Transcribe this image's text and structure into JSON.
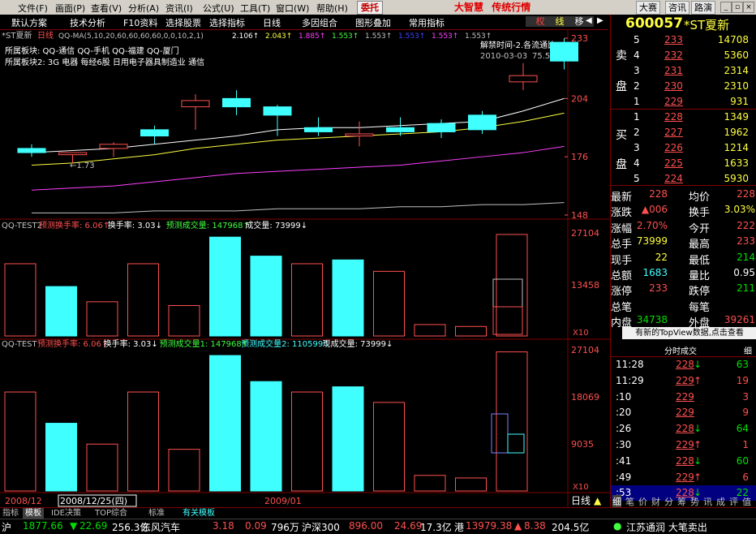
{
  "menubar": {
    "items": [
      "文件(F)",
      "画面(P)",
      "查看(V)",
      "分析(A)",
      "资讯(I)",
      "公式(U)",
      "工具(T)",
      "窗口(W)",
      "帮助(H)"
    ],
    "trade_label": "委托",
    "brand_name": "大智慧",
    "brand_slogan": "传统行情",
    "tab_dajiang": "大赛",
    "tab_zixun": "咨讯",
    "tab_lulun": "路演"
  },
  "toolbar": {
    "items": [
      "默认方案",
      "技术分析",
      "F10资料",
      "选择股票",
      "选择指标",
      "日线",
      "多因组合",
      "图形叠加",
      "常用指标"
    ],
    "right_buttons": [
      "权",
      "线",
      "移"
    ]
  },
  "chart": {
    "title_stock": "*ST夏新",
    "title_period": "日线",
    "ma_header": "QQ-MA(5,10,20,60,60,60,60,0,0,10,2,1)",
    "ma_values": [
      {
        "v": "2.106↑",
        "color": "#ffffff"
      },
      {
        "v": "2.043↑",
        "color": "#ffff40"
      },
      {
        "v": "1.885↑",
        "color": "#ff40ff"
      },
      {
        "v": "1.553↑",
        "color": "#40ff40"
      },
      {
        "v": "1.553↑",
        "color": "#c0c0c0"
      },
      {
        "v": "1.553↑",
        "color": "#4040ff"
      },
      {
        "v": "1.553↑",
        "color": "#ff40ff"
      },
      {
        "v": "1.553↑",
        "color": "#c0c0c0"
      }
    ],
    "board1": "所属板块: QQ-通信 QQ-手机 QQ-福建 QQ-厦门",
    "board2": "所属板块2: 3G 电器 每经6股 日用电子器具制造业 通信",
    "info_box": "解禁时间-2.各流通比",
    "info_date": "2010-03-03",
    "info_pct": "75.5%",
    "low_label": "1.73",
    "price_axis": [
      "233",
      "204",
      "176",
      "148"
    ]
  },
  "panel2": {
    "title": "QQ-TEST2",
    "legend": [
      {
        "label": "预测换手率: 6.06↑",
        "color": "#ff5050"
      },
      {
        "label": "换手率: 3.03↓",
        "color": "#ffffff"
      },
      {
        "label": "预测成交量: 147968↑",
        "color": "#40ff40"
      },
      {
        "label": "成交量: 73999↓",
        "color": "#ffffff"
      }
    ],
    "axis": [
      "27104",
      "13458",
      "X10"
    ]
  },
  "panel3": {
    "title": "QQ-TEST",
    "legend": [
      {
        "label": "预测换手率: 6.06↑",
        "color": "#ff5050"
      },
      {
        "label": "换手率: 3.03↓",
        "color": "#ffffff"
      },
      {
        "label": "预测成交量1: 147968↑",
        "color": "#40ff40"
      },
      {
        "label": "预测成交量2: 110599↑",
        "color": "#40ffff"
      },
      {
        "label": "现成交量: 73999↓",
        "color": "#ffffff"
      }
    ],
    "axis": [
      "27104",
      "18069",
      "9035",
      "X10"
    ]
  },
  "dates": {
    "d1": "2008/12",
    "d2": "2008/12/25(四)",
    "d3": "2009/01"
  },
  "period_label": "日线",
  "quote": {
    "code": "600057",
    "name": "*ST夏新",
    "sell_label": [
      "卖",
      "盘"
    ],
    "buy_label": [
      "买",
      "盘"
    ],
    "asks": [
      {
        "lvl": "5",
        "price": "233",
        "vol": "14708"
      },
      {
        "lvl": "4",
        "price": "232",
        "vol": "5360"
      },
      {
        "lvl": "3",
        "price": "231",
        "vol": "2314"
      },
      {
        "lvl": "2",
        "price": "230",
        "vol": "2310"
      },
      {
        "lvl": "1",
        "price": "229",
        "vol": "931"
      }
    ],
    "bids": [
      {
        "lvl": "1",
        "price": "228",
        "vol": "1349"
      },
      {
        "lvl": "2",
        "price": "227",
        "vol": "1962"
      },
      {
        "lvl": "3",
        "price": "226",
        "vol": "1214"
      },
      {
        "lvl": "4",
        "price": "225",
        "vol": "1633"
      },
      {
        "lvl": "5",
        "price": "224",
        "vol": "5930"
      }
    ],
    "stats": [
      {
        "k1": "最新",
        "v1": "228",
        "c1": "#ff5050",
        "k2": "均价",
        "v2": "228",
        "c2": "#ff5050"
      },
      {
        "k1": "涨跌",
        "v1": "▲006",
        "c1": "#ff5050",
        "k2": "换手",
        "v2": "3.03%",
        "c2": "#ffff40"
      },
      {
        "k1": "涨幅",
        "v1": "2.70%",
        "c1": "#ff5050",
        "k2": "今开",
        "v2": "222",
        "c2": "#ff5050"
      },
      {
        "k1": "总手",
        "v1": "73999",
        "c1": "#ffff40",
        "k2": "最高",
        "v2": "233",
        "c2": "#ff5050"
      },
      {
        "k1": "现手",
        "v1": "22",
        "c1": "#ffff40",
        "k2": "最低",
        "v2": "214",
        "c2": "#00e000"
      },
      {
        "k1": "总额",
        "v1": "1683",
        "c1": "#40ffff",
        "k2": "量比",
        "v2": "0.95",
        "c2": "#ffffff"
      },
      {
        "k1": "涨停",
        "v1": "233",
        "c1": "#ff5050",
        "k2": "跌停",
        "v2": "211",
        "c2": "#00e000"
      },
      {
        "k1": "总笔",
        "v1": "",
        "c1": "#ffffff",
        "k2": "每笔",
        "v2": "",
        "c2": "#ffffff"
      },
      {
        "k1": "内盘",
        "v1": "34738",
        "c1": "#00e000",
        "k2": "外盘",
        "v2": "39261",
        "c2": "#ff5050"
      }
    ],
    "notice": "有新的TopView数据,点击查看",
    "ticks_title": "分时成交",
    "ticks_btn": "细",
    "ticks": [
      {
        "t": "11:28",
        "p": "228",
        "arrow": "↓",
        "v": "63",
        "pc": "#ff5050",
        "ac": "#00e000",
        "vc": "#00e000"
      },
      {
        "t": "11:29",
        "p": "229",
        "arrow": "↑",
        "v": "19",
        "pc": "#ff5050",
        "ac": "#ff5050",
        "vc": "#ff5050"
      },
      {
        "t": ":10",
        "p": "229",
        "arrow": "",
        "v": "3",
        "pc": "#ff5050",
        "ac": "#ff5050",
        "vc": "#ff5050"
      },
      {
        "t": ":20",
        "p": "229",
        "arrow": "",
        "v": "9",
        "pc": "#ff5050",
        "ac": "#ff5050",
        "vc": "#ff5050"
      },
      {
        "t": ":26",
        "p": "228",
        "arrow": "↓",
        "v": "64",
        "pc": "#ff5050",
        "ac": "#00e000",
        "vc": "#00e000"
      },
      {
        "t": ":30",
        "p": "229",
        "arrow": "↑",
        "v": "1",
        "pc": "#ff5050",
        "ac": "#ff5050",
        "vc": "#ff5050"
      },
      {
        "t": ":41",
        "p": "228",
        "arrow": "↓",
        "v": "60",
        "pc": "#ff5050",
        "ac": "#00e000",
        "vc": "#00e000"
      },
      {
        "t": ":49",
        "p": "229",
        "arrow": "↑",
        "v": "6",
        "pc": "#ff5050",
        "ac": "#ff5050",
        "vc": "#ff5050"
      },
      {
        "t": ":53",
        "p": "228",
        "arrow": "↓",
        "v": "22",
        "pc": "#ff5050",
        "ac": "#00e000",
        "vc": "#00e000"
      }
    ],
    "tabs": [
      "细",
      "笔",
      "价",
      "财",
      "分",
      "筹",
      "势",
      "讯",
      "成",
      "评",
      "值"
    ]
  },
  "bottom": {
    "tabs": [
      "指标",
      "模板",
      "IDE决策",
      "TOP综合",
      "",
      "标准",
      "",
      "有关模板"
    ]
  },
  "status": {
    "items": [
      {
        "t": "沪",
        "c": "#ffffff"
      },
      {
        "t": "1877.66",
        "c": "#00e000"
      },
      {
        "t": "▼",
        "c": "#00e000"
      },
      {
        "t": "22.69",
        "c": "#00e000"
      },
      {
        "t": "256.3亿",
        "c": "#ffffff"
      },
      {
        "t": "东风汽车",
        "c": "#ffffff"
      },
      {
        "t": "3.18",
        "c": "#ff5050"
      },
      {
        "t": "0.09",
        "c": "#ff5050"
      },
      {
        "t": "796万",
        "c": "#ffffff"
      },
      {
        "t": "沪深300",
        "c": "#ffffff"
      },
      {
        "t": "896.00",
        "c": "#ff5050"
      },
      {
        "t": "24.69",
        "c": "#ff5050"
      },
      {
        "t": "17.3亿",
        "c": "#ffffff"
      },
      {
        "t": "港",
        "c": "#ffffff"
      },
      {
        "t": "13979.38",
        "c": "#ff5050"
      },
      {
        "t": "▲",
        "c": "#ff5050"
      },
      {
        "t": "8.38",
        "c": "#ff5050"
      },
      {
        "t": "204.5亿",
        "c": "#ffffff"
      },
      {
        "t": "●",
        "c": "#40ff40"
      },
      {
        "t": "江苏通润 大笔卖出",
        "c": "#ffffff"
      }
    ]
  },
  "chart_data": {
    "type": "table",
    "candles": [
      {
        "o": 180,
        "c": 178,
        "h": 182,
        "l": 176
      },
      {
        "o": 177,
        "c": 178,
        "h": 178,
        "l": 173
      },
      {
        "o": 180,
        "c": 182,
        "h": 183,
        "l": 176
      },
      {
        "o": 189,
        "c": 186,
        "h": 191,
        "l": 182
      },
      {
        "o": 200,
        "c": 203,
        "h": 206,
        "l": 189
      },
      {
        "o": 204,
        "c": 200,
        "h": 208,
        "l": 196
      },
      {
        "o": 200,
        "c": 196,
        "h": 201,
        "l": 186
      },
      {
        "o": 190,
        "c": 188,
        "h": 195,
        "l": 186
      },
      {
        "o": 186,
        "c": 187,
        "h": 193,
        "l": 181
      },
      {
        "o": 190,
        "c": 188,
        "h": 195,
        "l": 186
      },
      {
        "o": 192,
        "c": 188,
        "h": 194,
        "l": 185
      },
      {
        "o": 196,
        "c": 189,
        "h": 198,
        "l": 187
      },
      {
        "o": 212,
        "c": 215,
        "h": 221,
        "l": 208
      },
      {
        "o": 231,
        "c": 222,
        "h": 233,
        "l": 218
      }
    ],
    "ma1": [
      178,
      179,
      180,
      182,
      184,
      186,
      189,
      190,
      190,
      191,
      192,
      193,
      198,
      204
    ],
    "ma2": [
      172,
      173,
      175,
      177,
      180,
      182,
      184,
      185,
      186,
      187,
      188,
      190,
      193,
      197
    ],
    "ma3": [
      160,
      161,
      162,
      164,
      166,
      168,
      169,
      170,
      171,
      172,
      174,
      176,
      178,
      181
    ],
    "ma4": [
      149,
      149,
      149,
      150,
      150,
      150,
      151,
      151,
      151,
      152,
      152,
      153,
      153,
      154
    ],
    "vol2": [
      19000,
      13000,
      9000,
      19000,
      8000,
      26000,
      21000,
      19000,
      20000,
      17000,
      3000,
      2500,
      26700,
      0
    ],
    "vol2_hollow": [
      true,
      false,
      true,
      true,
      true,
      false,
      false,
      true,
      false,
      true,
      true,
      true,
      true,
      true
    ],
    "vol3": [
      19000,
      13000,
      9000,
      19000,
      8000,
      26000,
      21000,
      19000,
      20000,
      17000,
      3000,
      2500,
      26700,
      0
    ],
    "ylim_price": [
      148,
      233
    ],
    "ylim_vol": [
      0,
      27104
    ]
  }
}
